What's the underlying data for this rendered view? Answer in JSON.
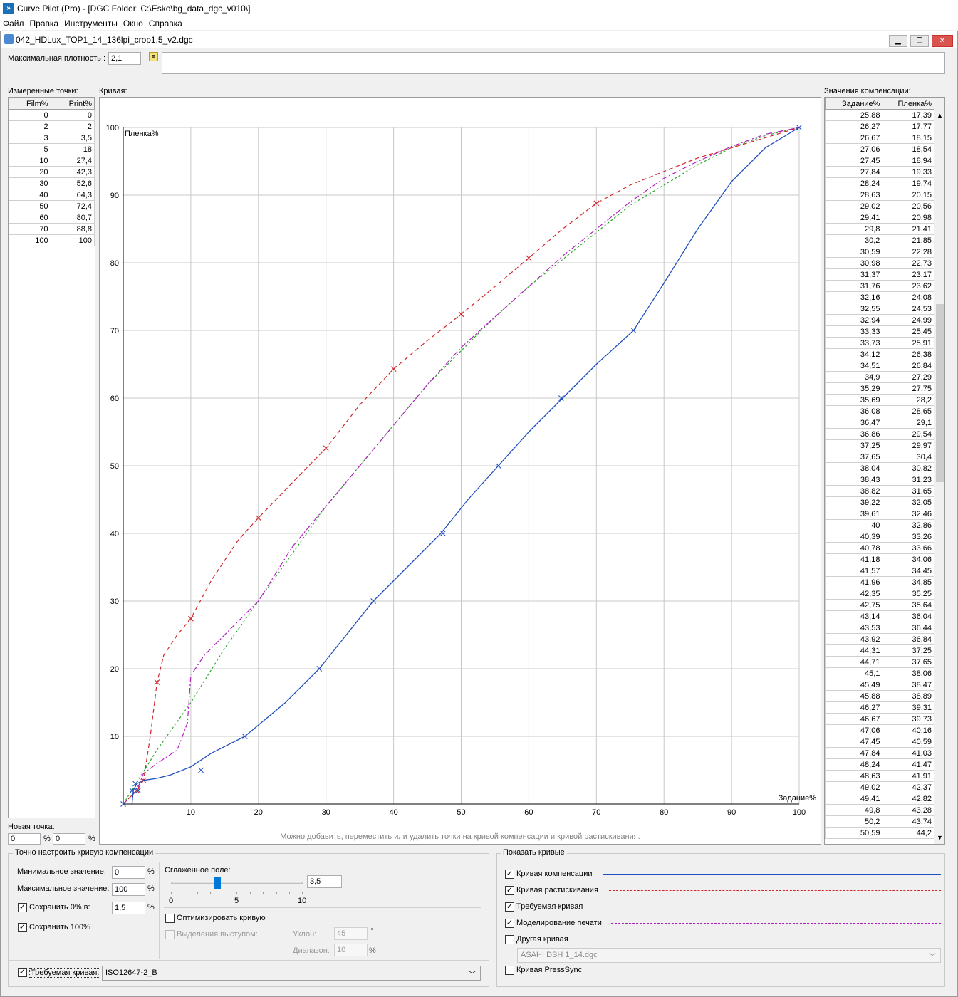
{
  "window": {
    "app_title": "Curve Pilot (Pro) - [DGC Folder: C:\\Esko\\bg_data_dgc_v010\\]",
    "doc_title": "042_HDLux_TOP1_14_136lpi_crop1,5_v2.dgc"
  },
  "menu": [
    "Файл",
    "Правка",
    "Инструменты",
    "Окно",
    "Справка"
  ],
  "top": {
    "max_density_label": "Максимальная плотность :",
    "max_density_value": "2,1",
    "note_value": ""
  },
  "measured": {
    "label": "Измеренные точки:",
    "col_film": "Film%",
    "col_print": "Print%",
    "rows": [
      [
        "0",
        "0"
      ],
      [
        "2",
        "2"
      ],
      [
        "3",
        "3,5"
      ],
      [
        "5",
        "18"
      ],
      [
        "10",
        "27,4"
      ],
      [
        "20",
        "42,3"
      ],
      [
        "30",
        "52,6"
      ],
      [
        "40",
        "64,3"
      ],
      [
        "50",
        "72,4"
      ],
      [
        "60",
        "80,7"
      ],
      [
        "70",
        "88,8"
      ],
      [
        "100",
        "100"
      ]
    ]
  },
  "new_point": {
    "label": "Новая точка:",
    "film": "0",
    "print": "0",
    "unit": "%"
  },
  "curve_label": "Кривая:",
  "hint": "Можно добавить, переместить или удалить точки на кривой компенсации и кривой растискивания.",
  "chart_data": {
    "type": "line",
    "ylabel": "Пленка%",
    "xlabel": "Задание%",
    "xlim": [
      0,
      100
    ],
    "ylim": [
      0,
      100
    ],
    "x_ticks": [
      "10",
      "20",
      "30",
      "40",
      "50",
      "60",
      "70",
      "80",
      "90",
      "100"
    ],
    "y_ticks": [
      "10",
      "20",
      "30",
      "40",
      "50",
      "60",
      "70",
      "80",
      "90",
      "100"
    ],
    "grid": true,
    "series": [
      {
        "name": "Кривая компенсации",
        "color": "#1f4fbf",
        "dash": "",
        "x": [
          1.3,
          1.5,
          2,
          3,
          5,
          7,
          10,
          13,
          18,
          24,
          29,
          33,
          37,
          42,
          47,
          51,
          55.5,
          60,
          65,
          70,
          75.5,
          80,
          85,
          90,
          95,
          100
        ],
        "y": [
          0,
          2,
          3,
          3.5,
          3.8,
          4.3,
          5.5,
          7.5,
          10,
          15,
          20,
          25,
          30,
          35,
          40,
          45,
          50,
          55,
          60,
          65,
          70,
          77,
          85,
          92,
          97,
          100
        ],
        "markers": [
          [
            0,
            0
          ],
          [
            1.3,
            2
          ],
          [
            1.8,
            3
          ],
          [
            2.2,
            2
          ],
          [
            11.5,
            5
          ],
          [
            18,
            10
          ],
          [
            29,
            20
          ],
          [
            37,
            30
          ],
          [
            47.3,
            40
          ],
          [
            55.5,
            50
          ],
          [
            64.8,
            60
          ],
          [
            75.5,
            70
          ],
          [
            100,
            100
          ]
        ]
      },
      {
        "name": "Кривая растискивания",
        "color": "#d0262a",
        "dash": "6,4",
        "x": [
          0,
          2,
          3,
          4,
          5,
          6,
          8,
          10,
          13,
          17,
          20,
          25,
          30,
          35,
          40,
          45,
          50,
          55,
          60,
          65,
          70,
          75,
          80,
          85,
          90,
          95,
          100
        ],
        "y": [
          0,
          2,
          3.5,
          10,
          18,
          22,
          25,
          27.4,
          33,
          39,
          42.3,
          47.5,
          52.6,
          59,
          64.3,
          68.5,
          72.4,
          76.5,
          80.7,
          85,
          88.8,
          91.5,
          93.5,
          95.5,
          97,
          98.5,
          100
        ],
        "markers": [
          [
            2,
            2
          ],
          [
            3,
            3.5
          ],
          [
            5,
            18
          ],
          [
            10,
            27.4
          ],
          [
            20,
            42.3
          ],
          [
            30,
            52.6
          ],
          [
            40,
            64.3
          ],
          [
            50,
            72.4
          ],
          [
            60,
            80.7
          ],
          [
            70,
            88.8
          ]
        ]
      },
      {
        "name": "Требуемая кривая",
        "color": "#2aa62a",
        "dash": "3,3",
        "x": [
          0,
          5,
          10,
          15,
          20,
          25,
          30,
          35,
          40,
          45,
          50,
          55,
          60,
          65,
          70,
          75,
          80,
          85,
          90,
          95,
          100
        ],
        "y": [
          0,
          8,
          15,
          23,
          30,
          37,
          44,
          50,
          56,
          62,
          67,
          72,
          76.5,
          80.5,
          84.5,
          88.5,
          91.5,
          94.5,
          97,
          98.8,
          100
        ]
      },
      {
        "name": "Моделирование печати",
        "color": "#b020c0",
        "dash": "8,3,2,3",
        "x": [
          0,
          2,
          3,
          5,
          8,
          9.5,
          10,
          12,
          15,
          20,
          25,
          30,
          35,
          40,
          45,
          50,
          55,
          60,
          65,
          70,
          75,
          80,
          85,
          90,
          95,
          100
        ],
        "y": [
          0,
          2,
          4.5,
          6,
          8,
          12,
          19,
          22,
          25,
          30,
          38,
          44,
          50,
          56,
          62,
          67.5,
          72,
          76.5,
          81,
          85,
          89,
          92.5,
          95,
          97.2,
          99,
          100
        ]
      }
    ]
  },
  "comp_values": {
    "label": "Значения компенсации:",
    "col_task": "Задание%",
    "col_film": "Пленка%",
    "rows": [
      [
        "25,88",
        "17,39"
      ],
      [
        "26,27",
        "17,77"
      ],
      [
        "26,67",
        "18,15"
      ],
      [
        "27,06",
        "18,54"
      ],
      [
        "27,45",
        "18,94"
      ],
      [
        "27,84",
        "19,33"
      ],
      [
        "28,24",
        "19,74"
      ],
      [
        "28,63",
        "20,15"
      ],
      [
        "29,02",
        "20,56"
      ],
      [
        "29,41",
        "20,98"
      ],
      [
        "29,8",
        "21,41"
      ],
      [
        "30,2",
        "21,85"
      ],
      [
        "30,59",
        "22,28"
      ],
      [
        "30,98",
        "22,73"
      ],
      [
        "31,37",
        "23,17"
      ],
      [
        "31,76",
        "23,62"
      ],
      [
        "32,16",
        "24,08"
      ],
      [
        "32,55",
        "24,53"
      ],
      [
        "32,94",
        "24,99"
      ],
      [
        "33,33",
        "25,45"
      ],
      [
        "33,73",
        "25,91"
      ],
      [
        "34,12",
        "26,38"
      ],
      [
        "34,51",
        "26,84"
      ],
      [
        "34,9",
        "27,29"
      ],
      [
        "35,29",
        "27,75"
      ],
      [
        "35,69",
        "28,2"
      ],
      [
        "36,08",
        "28,65"
      ],
      [
        "36,47",
        "29,1"
      ],
      [
        "36,86",
        "29,54"
      ],
      [
        "37,25",
        "29,97"
      ],
      [
        "37,65",
        "30,4"
      ],
      [
        "38,04",
        "30,82"
      ],
      [
        "38,43",
        "31,23"
      ],
      [
        "38,82",
        "31,65"
      ],
      [
        "39,22",
        "32,05"
      ],
      [
        "39,61",
        "32,46"
      ],
      [
        "40",
        "32,86"
      ],
      [
        "40,39",
        "33,26"
      ],
      [
        "40,78",
        "33,66"
      ],
      [
        "41,18",
        "34,06"
      ],
      [
        "41,57",
        "34,45"
      ],
      [
        "41,96",
        "34,85"
      ],
      [
        "42,35",
        "35,25"
      ],
      [
        "42,75",
        "35,64"
      ],
      [
        "43,14",
        "36,04"
      ],
      [
        "43,53",
        "36,44"
      ],
      [
        "43,92",
        "36,84"
      ],
      [
        "44,31",
        "37,25"
      ],
      [
        "44,71",
        "37,65"
      ],
      [
        "45,1",
        "38,06"
      ],
      [
        "45,49",
        "38,47"
      ],
      [
        "45,88",
        "38,89"
      ],
      [
        "46,27",
        "39,31"
      ],
      [
        "46,67",
        "39,73"
      ],
      [
        "47,06",
        "40,16"
      ],
      [
        "47,45",
        "40,59"
      ],
      [
        "47,84",
        "41,03"
      ],
      [
        "48,24",
        "41,47"
      ],
      [
        "48,63",
        "41,91"
      ],
      [
        "49,02",
        "42,37"
      ],
      [
        "49,41",
        "42,82"
      ],
      [
        "49,8",
        "43,28"
      ],
      [
        "50,2",
        "43,74"
      ],
      [
        "50,59",
        "44,2"
      ]
    ]
  },
  "fine_tune": {
    "title": "Точно настроить кривую компенсации",
    "min_label": "Минимальное значение:",
    "min_value": "0",
    "max_label": "Максимальное значение:",
    "max_value": "100",
    "keep0_label": "Сохранить 0% в:",
    "keep0_value": "1,5",
    "keep100_label": "Сохранить 100%",
    "pct": "%",
    "smooth_label": "Сглаженное поле:",
    "smooth_value": "3,5",
    "smooth_level": 3.5,
    "slider_ticks": [
      "0",
      "5",
      "10"
    ],
    "optimize_label": "Оптимизировать кривую",
    "bump_label": "Выделения выступом:",
    "slope_label": "Уклон:",
    "slope_value": "45",
    "slope_unit": "°",
    "range_label": "Диапазон:",
    "range_value": "10",
    "range_unit": "%",
    "required_label": "Требуемая кривая:",
    "required_value": "ISO12647-2_B"
  },
  "show_curves": {
    "title": "Показать кривые",
    "items": [
      {
        "label": "Кривая компенсации",
        "checked": true
      },
      {
        "label": "Кривая растискивания",
        "checked": true
      },
      {
        "label": "Требуемая кривая",
        "checked": true
      },
      {
        "label": "Моделирование печати",
        "checked": true
      },
      {
        "label": "Другая кривая",
        "checked": false
      },
      {
        "label": "Кривая PressSync",
        "checked": false
      }
    ],
    "other_curve_value": "ASAHI DSH 1_14.dgc"
  }
}
